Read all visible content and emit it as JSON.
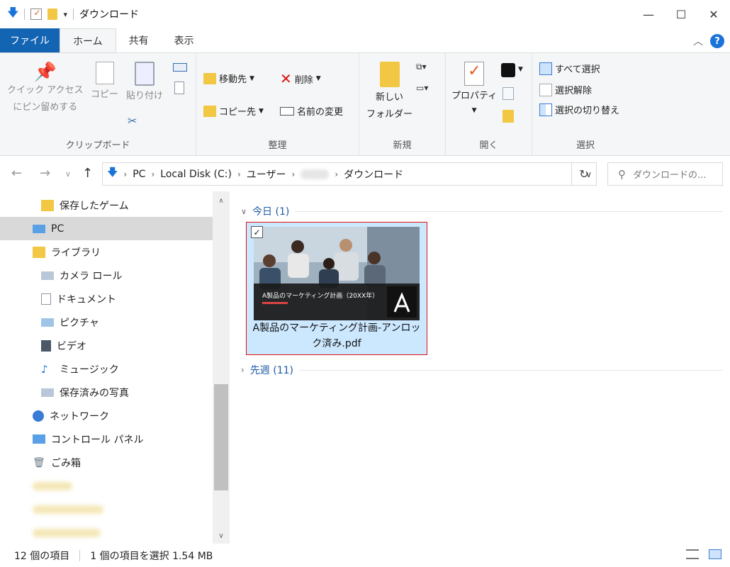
{
  "window": {
    "title": "ダウンロード"
  },
  "tabs": [
    {
      "label": "ファイル"
    },
    {
      "label": "ホーム"
    },
    {
      "label": "共有"
    },
    {
      "label": "表示"
    }
  ],
  "ribbon": {
    "clipboard": {
      "label": "クリップボード",
      "pin_line1": "クイック アクセス",
      "pin_line2": "にピン留めする",
      "copy": "コピー",
      "paste": "貼り付け"
    },
    "organize": {
      "label": "整理",
      "move_to": "移動先",
      "copy_to": "コピー先",
      "delete": "削除",
      "rename": "名前の変更"
    },
    "new": {
      "label": "新規",
      "new_folder_line1": "新しい",
      "new_folder_line2": "フォルダー"
    },
    "open": {
      "label": "開く",
      "properties": "プロパティ"
    },
    "select": {
      "label": "選択",
      "select_all": "すべて選択",
      "select_none": "選択解除",
      "invert": "選択の切り替え"
    }
  },
  "address": {
    "crumbs": [
      "PC",
      "Local Disk (C:)",
      "ユーザー",
      "ダウンロード"
    ]
  },
  "search": {
    "placeholder": "ダウンロードの..."
  },
  "navpane": {
    "items": [
      {
        "label": "保存したゲーム"
      },
      {
        "label": "PC"
      },
      {
        "label": "ライブラリ"
      },
      {
        "label": "カメラ ロール"
      },
      {
        "label": "ドキュメント"
      },
      {
        "label": "ピクチャ"
      },
      {
        "label": "ビデオ"
      },
      {
        "label": "ミュージック"
      },
      {
        "label": "保存済みの写真"
      },
      {
        "label": "ネットワーク"
      },
      {
        "label": "コントロール パネル"
      },
      {
        "label": "ごみ箱"
      }
    ]
  },
  "content": {
    "today": "今日 (1)",
    "last_week": "先週 (11)",
    "file": {
      "name": "A製品のマーケティング計画-アンロック済み.pdf",
      "thumb_title": "A製品のマーケティング計画（20XX年）"
    }
  },
  "status": {
    "count": "12 個の項目",
    "selection": "1 個の項目を選択  1.54 MB"
  },
  "colors": {
    "accent": "#1464b4",
    "selection": "#cce8ff",
    "highlight_border": "#dd1111",
    "section_text": "#1e5aa8"
  }
}
